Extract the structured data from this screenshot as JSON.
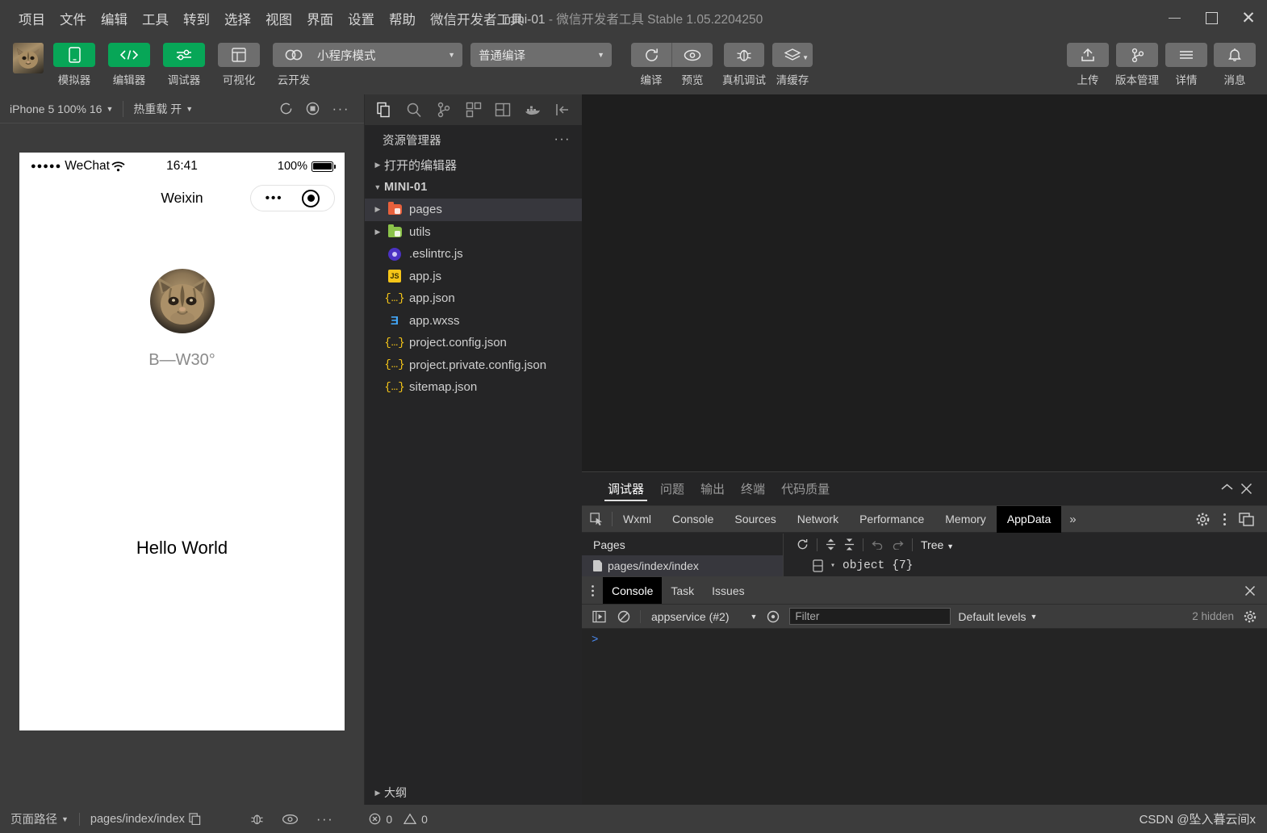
{
  "window": {
    "title_project": "mini-01",
    "title_dash": "-",
    "title_rest": "微信开发者工具 Stable 1.05.2204250",
    "app_name": "微信开发者工具"
  },
  "menubar": {
    "items": [
      "项目",
      "文件",
      "编辑",
      "工具",
      "转到",
      "选择",
      "视图",
      "界面",
      "设置",
      "帮助"
    ]
  },
  "toolbar": {
    "mode_buttons": [
      {
        "label": "模拟器",
        "icon": "phone-icon",
        "state": "active"
      },
      {
        "label": "编辑器",
        "icon": "code-icon",
        "state": "active"
      },
      {
        "label": "调试器",
        "icon": "sliders-icon",
        "state": "active"
      },
      {
        "label": "可视化",
        "icon": "layout-icon",
        "state": "inactive"
      },
      {
        "label": "云开发",
        "icon": "cloud-icon",
        "state": "inactive"
      }
    ],
    "mode_select": "小程序模式",
    "compile_select": "普通编译",
    "actions": [
      {
        "label": "编译",
        "icon": "refresh-icon"
      },
      {
        "label": "预览",
        "icon": "eye-icon"
      },
      {
        "label": "真机调试",
        "icon": "bug-icon"
      },
      {
        "label": "清缓存",
        "icon": "layers-icon"
      }
    ],
    "right_actions": [
      {
        "label": "上传",
        "icon": "upload-icon"
      },
      {
        "label": "版本管理",
        "icon": "branch-icon"
      },
      {
        "label": "详情",
        "icon": "menu-icon"
      },
      {
        "label": "消息",
        "icon": "bell-icon"
      }
    ]
  },
  "simulator": {
    "device": "iPhone 5 100% 16",
    "hot_reload": "热重载 开",
    "phone": {
      "status_dots": "●●●●●",
      "carrier": "WeChat",
      "time": "16:41",
      "battery_percent": "100%",
      "nav_title": "Weixin",
      "capsule_dots": "•••",
      "nickname": "B—W30°",
      "hello": "Hello World"
    }
  },
  "explorer": {
    "title": "资源管理器",
    "more": "···",
    "activity_icons": [
      "files-icon",
      "search-icon",
      "source-control-icon",
      "extensions-icon",
      "layout-icon",
      "docker-icon",
      "collapse-icon"
    ],
    "sections": {
      "open_editors": "打开的编辑器",
      "project": "MINI-01",
      "outline": "大纲"
    },
    "files": [
      {
        "name": "pages",
        "type": "folder",
        "color": "red",
        "expandable": true,
        "selected": true
      },
      {
        "name": "utils",
        "type": "folder",
        "color": "green",
        "expandable": true,
        "selected": false
      },
      {
        "name": ".eslintrc.js",
        "type": "eslint",
        "selected": false
      },
      {
        "name": "app.js",
        "type": "js",
        "selected": false
      },
      {
        "name": "app.json",
        "type": "json",
        "selected": false
      },
      {
        "name": "app.wxss",
        "type": "wxss",
        "selected": false
      },
      {
        "name": "project.config.json",
        "type": "json",
        "selected": false
      },
      {
        "name": "project.private.config.json",
        "type": "json",
        "selected": false
      },
      {
        "name": "sitemap.json",
        "type": "json",
        "selected": false
      }
    ]
  },
  "debugger": {
    "panel_tabs": [
      {
        "label": "调试器",
        "active": true
      },
      {
        "label": "问题",
        "active": false
      },
      {
        "label": "输出",
        "active": false
      },
      {
        "label": "终端",
        "active": false
      },
      {
        "label": "代码质量",
        "active": false
      }
    ],
    "devtools_tabs": [
      {
        "label": "Wxml",
        "active": false
      },
      {
        "label": "Console",
        "active": false
      },
      {
        "label": "Sources",
        "active": false
      },
      {
        "label": "Network",
        "active": false
      },
      {
        "label": "Performance",
        "active": false
      },
      {
        "label": "Memory",
        "active": false
      },
      {
        "label": "AppData",
        "active": true
      }
    ],
    "devtools_more": "»",
    "appdata": {
      "pages_header": "Pages",
      "page_item": "pages/index/index",
      "view_mode": "Tree",
      "root_object": "object",
      "root_count": "{7}",
      "root_caret": "▾"
    },
    "console": {
      "tabs": [
        {
          "label": "Console",
          "active": true
        },
        {
          "label": "Task",
          "active": false
        },
        {
          "label": "Issues",
          "active": false
        }
      ],
      "context": "appservice (#2)",
      "filter_placeholder": "Filter",
      "levels": "Default levels",
      "hidden": "2 hidden",
      "prompt": ">"
    }
  },
  "statusbar": {
    "page_path_label": "页面路径",
    "page_path": "pages/index/index",
    "errors": "0",
    "warnings": "0",
    "watermark": "CSDN @坠入暮云间x"
  },
  "colors": {
    "accent_green": "#07a657",
    "window_bg": "#3c3c3c",
    "panel_bg": "#252526",
    "editor_bg": "#1e1e1e",
    "selected_row": "#37373d",
    "prompt_blue": "#4b8df8"
  }
}
